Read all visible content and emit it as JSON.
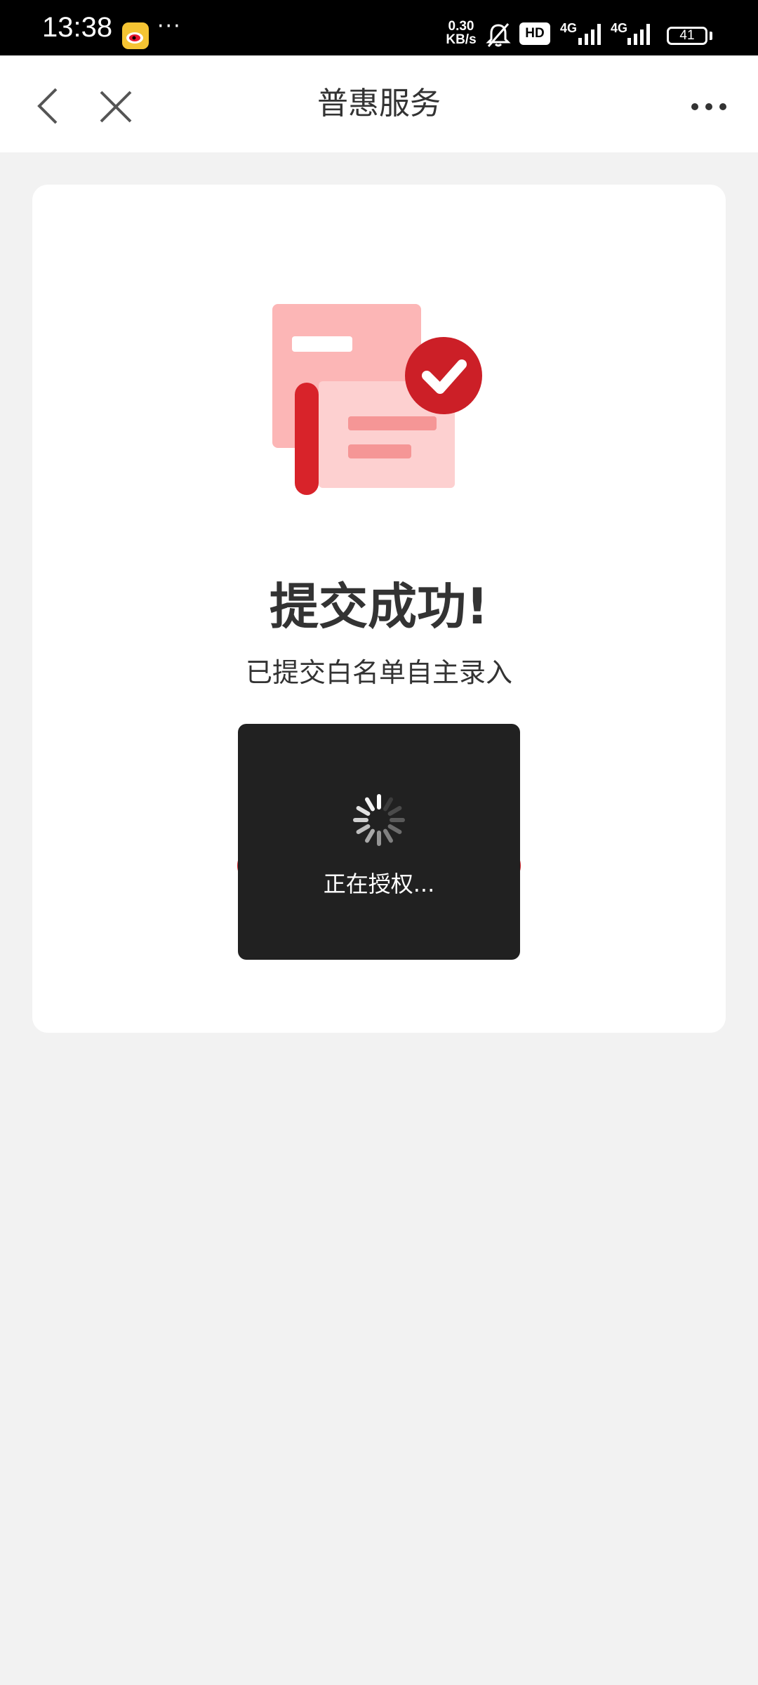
{
  "status_bar": {
    "time": "13:38",
    "overflow": "···",
    "net_speed_value": "0.30",
    "net_speed_unit": "KB/s",
    "hd_badge": "HD",
    "network_1": "4G",
    "network_2": "4G",
    "battery": "41",
    "icons": [
      "weibo-app-icon",
      "mute-bell-icon",
      "signal-icon",
      "battery-icon"
    ]
  },
  "header": {
    "title": "普惠服务",
    "back_icon": "chevron-left-icon",
    "close_icon": "close-icon",
    "more_icon": "more-horizontal-icon"
  },
  "result": {
    "title": "提交成功!",
    "subtitle": "已提交白名单自主录入"
  },
  "toast": {
    "text": "正在授权..."
  },
  "colors": {
    "accent": "#d8232a",
    "card_bg": "#ffffff",
    "page_bg": "#f2f2f2",
    "toast_bg": "#212121"
  }
}
